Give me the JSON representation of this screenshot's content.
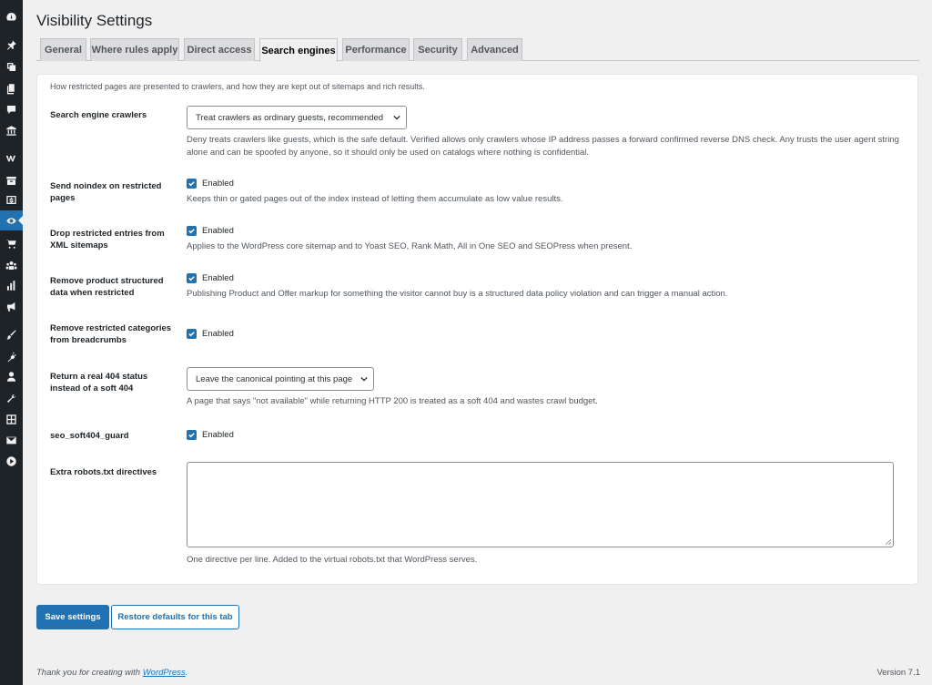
{
  "page": {
    "title": "Visibility Settings"
  },
  "sidebar": {
    "icons": [
      "dashboard-icon",
      "pin-icon",
      "media-icon",
      "pages-icon",
      "comments-icon",
      "museum-icon",
      "woocommerce-icon",
      "archive-icon",
      "dollar-icon",
      "visibility-icon",
      "cart-icon",
      "groups-icon",
      "chart-icon",
      "megaphone-icon",
      "brush-icon",
      "plugin-icon",
      "user-icon",
      "wrench-icon",
      "grid-icon",
      "email-icon",
      "play-icon"
    ],
    "active": "visibility-icon"
  },
  "tabs": [
    {
      "label": "General",
      "active": false
    },
    {
      "label": "Where rules apply",
      "active": false
    },
    {
      "label": "Direct access",
      "active": false
    },
    {
      "label": "Search engines",
      "active": true
    },
    {
      "label": "Performance",
      "active": false
    },
    {
      "label": "Security",
      "active": false
    },
    {
      "label": "Advanced",
      "active": false
    }
  ],
  "intro": "How restricted pages are presented to crawlers, and how they are kept out of sitemaps and rich results.",
  "rows": {
    "crawlers": {
      "label": "Search engine crawlers",
      "select_value": "Treat crawlers as ordinary guests, recommended",
      "description": "Deny treats crawlers like guests, which is the safe default. Verified allows only crawlers whose IP address passes a forward confirmed reverse DNS check. Any trusts the user agent string alone and can be spoofed by anyone, so it should only be used on catalogs where nothing is confidential."
    },
    "noindex": {
      "label": "Send noindex on restricted pages",
      "checkbox_label": "Enabled",
      "checked": true,
      "description": "Keeps thin or gated pages out of the index instead of letting them accumulate as low value results."
    },
    "sitemaps": {
      "label": "Drop restricted entries from XML sitemaps",
      "checkbox_label": "Enabled",
      "checked": true,
      "description": "Applies to the WordPress core sitemap and to Yoast SEO, Rank Math, All in One SEO and SEOPress when present."
    },
    "structured": {
      "label": "Remove product structured data when restricted",
      "checkbox_label": "Enabled",
      "checked": true,
      "description": "Publishing Product and Offer markup for something the visitor cannot buy is a structured data policy violation and can trigger a manual action."
    },
    "breadcrumbs": {
      "label": "Remove restricted categories from breadcrumbs",
      "checkbox_label": "Enabled",
      "checked": true
    },
    "status404": {
      "label": "Return a real 404 status instead of a soft 404",
      "select_value": "Leave the canonical pointing at this page",
      "description": "A page that says \"not available\" while returning HTTP 200 is treated as a soft 404 and wastes crawl budget."
    },
    "soft404guard": {
      "label": "seo_soft404_guard",
      "checkbox_label": "Enabled",
      "checked": true
    },
    "robots": {
      "label": "Extra robots.txt directives",
      "value": "",
      "description": "One directive per line. Added to the virtual robots.txt that WordPress serves."
    }
  },
  "buttons": {
    "save": "Save settings",
    "restore": "Restore defaults for this tab"
  },
  "footer": {
    "thanks_prefix": "Thank you for creating with ",
    "thanks_link": "WordPress",
    "thanks_suffix": ".",
    "version": "Version 7.1"
  },
  "colors": {
    "accent": "#2271b1",
    "sidebar": "#1d2327",
    "background": "#f0f0f1"
  }
}
